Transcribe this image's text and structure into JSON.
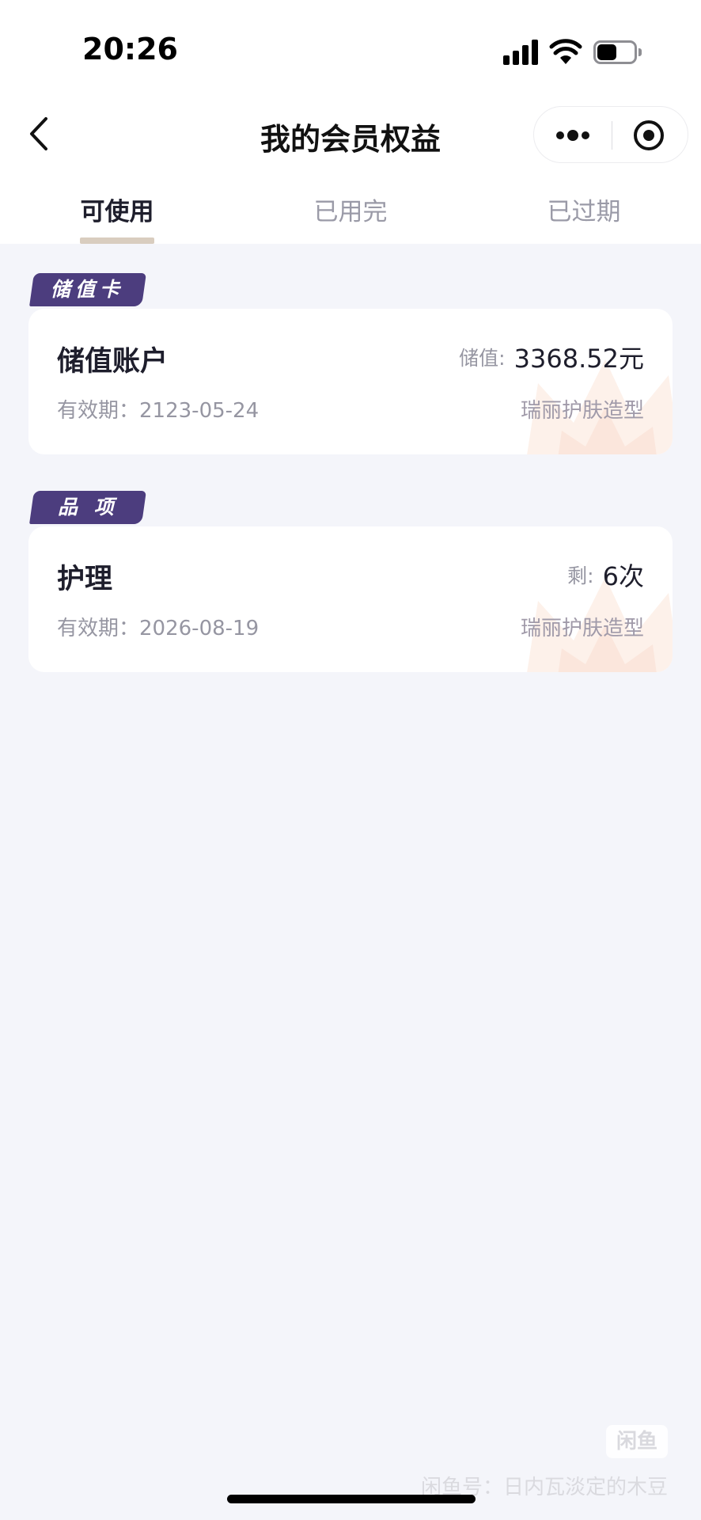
{
  "status_bar": {
    "time": "20:26"
  },
  "nav": {
    "title": "我的会员权益"
  },
  "tabs": [
    {
      "label": "可使用",
      "active": true
    },
    {
      "label": "已用完",
      "active": false
    },
    {
      "label": "已过期",
      "active": false
    }
  ],
  "sections": [
    {
      "badge": "储值卡",
      "card": {
        "title": "储值账户",
        "expiry_label": "有效期：",
        "expiry_date": "2123-05-24",
        "value_label": "储值:",
        "value": "3368.52元",
        "store": "瑞丽护肤造型"
      }
    },
    {
      "badge": "品 项",
      "card": {
        "title": "护理",
        "expiry_label": "有效期：",
        "expiry_date": "2026-08-19",
        "value_label": "剩:",
        "value": "6次",
        "store": "瑞丽护肤造型"
      }
    }
  ],
  "watermark": {
    "logo": "闲鱼",
    "text": "闲鱼号：日内瓦淡定的木豆"
  },
  "colors": {
    "badge": "#4c3d7e",
    "tab_indicator": "#d9cdbf",
    "page_background": "#f4f5fa"
  }
}
